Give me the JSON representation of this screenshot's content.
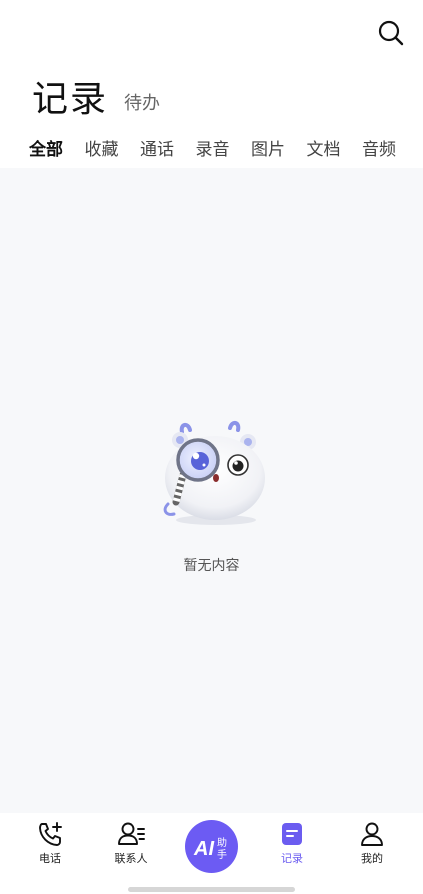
{
  "header": {
    "title": "记录",
    "subtitle": "待办",
    "search_icon": "search-icon"
  },
  "filter_tabs": [
    {
      "label": "全部",
      "active": true
    },
    {
      "label": "收藏",
      "active": false
    },
    {
      "label": "通话",
      "active": false
    },
    {
      "label": "录音",
      "active": false
    },
    {
      "label": "图片",
      "active": false
    },
    {
      "label": "文档",
      "active": false
    },
    {
      "label": "音频",
      "active": false
    }
  ],
  "empty_state": {
    "text": "暂无内容",
    "illustration": "mascot-magnifier-illustration"
  },
  "bottom_nav": {
    "items": [
      {
        "label": "电话",
        "icon": "phone-add-icon",
        "active": false
      },
      {
        "label": "联系人",
        "icon": "contacts-icon",
        "active": false
      },
      {
        "label": "记录",
        "icon": "record-icon",
        "active": true
      },
      {
        "label": "我的",
        "icon": "profile-icon",
        "active": false
      }
    ],
    "ai_button": {
      "text_main": "AI",
      "text_side_top": "助",
      "text_side_bottom": "手"
    }
  },
  "colors": {
    "accent": "#6c5bf3",
    "content_bg": "#f7f8fa",
    "active_label": "#6b5cf0"
  }
}
